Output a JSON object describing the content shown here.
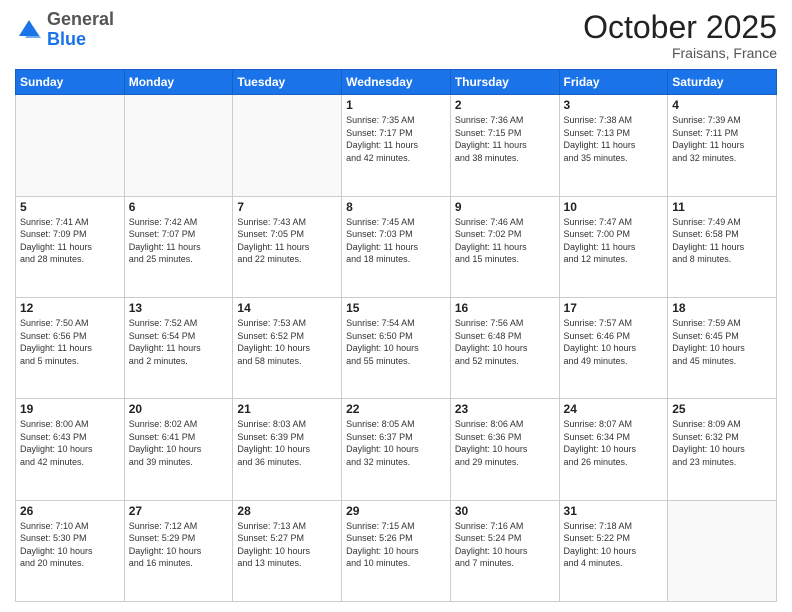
{
  "header": {
    "logo_general": "General",
    "logo_blue": "Blue",
    "month_title": "October 2025",
    "subtitle": "Fraisans, France"
  },
  "days_of_week": [
    "Sunday",
    "Monday",
    "Tuesday",
    "Wednesday",
    "Thursday",
    "Friday",
    "Saturday"
  ],
  "weeks": [
    [
      {
        "day": "",
        "info": ""
      },
      {
        "day": "",
        "info": ""
      },
      {
        "day": "",
        "info": ""
      },
      {
        "day": "1",
        "info": "Sunrise: 7:35 AM\nSunset: 7:17 PM\nDaylight: 11 hours\nand 42 minutes."
      },
      {
        "day": "2",
        "info": "Sunrise: 7:36 AM\nSunset: 7:15 PM\nDaylight: 11 hours\nand 38 minutes."
      },
      {
        "day": "3",
        "info": "Sunrise: 7:38 AM\nSunset: 7:13 PM\nDaylight: 11 hours\nand 35 minutes."
      },
      {
        "day": "4",
        "info": "Sunrise: 7:39 AM\nSunset: 7:11 PM\nDaylight: 11 hours\nand 32 minutes."
      }
    ],
    [
      {
        "day": "5",
        "info": "Sunrise: 7:41 AM\nSunset: 7:09 PM\nDaylight: 11 hours\nand 28 minutes."
      },
      {
        "day": "6",
        "info": "Sunrise: 7:42 AM\nSunset: 7:07 PM\nDaylight: 11 hours\nand 25 minutes."
      },
      {
        "day": "7",
        "info": "Sunrise: 7:43 AM\nSunset: 7:05 PM\nDaylight: 11 hours\nand 22 minutes."
      },
      {
        "day": "8",
        "info": "Sunrise: 7:45 AM\nSunset: 7:03 PM\nDaylight: 11 hours\nand 18 minutes."
      },
      {
        "day": "9",
        "info": "Sunrise: 7:46 AM\nSunset: 7:02 PM\nDaylight: 11 hours\nand 15 minutes."
      },
      {
        "day": "10",
        "info": "Sunrise: 7:47 AM\nSunset: 7:00 PM\nDaylight: 11 hours\nand 12 minutes."
      },
      {
        "day": "11",
        "info": "Sunrise: 7:49 AM\nSunset: 6:58 PM\nDaylight: 11 hours\nand 8 minutes."
      }
    ],
    [
      {
        "day": "12",
        "info": "Sunrise: 7:50 AM\nSunset: 6:56 PM\nDaylight: 11 hours\nand 5 minutes."
      },
      {
        "day": "13",
        "info": "Sunrise: 7:52 AM\nSunset: 6:54 PM\nDaylight: 11 hours\nand 2 minutes."
      },
      {
        "day": "14",
        "info": "Sunrise: 7:53 AM\nSunset: 6:52 PM\nDaylight: 10 hours\nand 58 minutes."
      },
      {
        "day": "15",
        "info": "Sunrise: 7:54 AM\nSunset: 6:50 PM\nDaylight: 10 hours\nand 55 minutes."
      },
      {
        "day": "16",
        "info": "Sunrise: 7:56 AM\nSunset: 6:48 PM\nDaylight: 10 hours\nand 52 minutes."
      },
      {
        "day": "17",
        "info": "Sunrise: 7:57 AM\nSunset: 6:46 PM\nDaylight: 10 hours\nand 49 minutes."
      },
      {
        "day": "18",
        "info": "Sunrise: 7:59 AM\nSunset: 6:45 PM\nDaylight: 10 hours\nand 45 minutes."
      }
    ],
    [
      {
        "day": "19",
        "info": "Sunrise: 8:00 AM\nSunset: 6:43 PM\nDaylight: 10 hours\nand 42 minutes."
      },
      {
        "day": "20",
        "info": "Sunrise: 8:02 AM\nSunset: 6:41 PM\nDaylight: 10 hours\nand 39 minutes."
      },
      {
        "day": "21",
        "info": "Sunrise: 8:03 AM\nSunset: 6:39 PM\nDaylight: 10 hours\nand 36 minutes."
      },
      {
        "day": "22",
        "info": "Sunrise: 8:05 AM\nSunset: 6:37 PM\nDaylight: 10 hours\nand 32 minutes."
      },
      {
        "day": "23",
        "info": "Sunrise: 8:06 AM\nSunset: 6:36 PM\nDaylight: 10 hours\nand 29 minutes."
      },
      {
        "day": "24",
        "info": "Sunrise: 8:07 AM\nSunset: 6:34 PM\nDaylight: 10 hours\nand 26 minutes."
      },
      {
        "day": "25",
        "info": "Sunrise: 8:09 AM\nSunset: 6:32 PM\nDaylight: 10 hours\nand 23 minutes."
      }
    ],
    [
      {
        "day": "26",
        "info": "Sunrise: 7:10 AM\nSunset: 5:30 PM\nDaylight: 10 hours\nand 20 minutes."
      },
      {
        "day": "27",
        "info": "Sunrise: 7:12 AM\nSunset: 5:29 PM\nDaylight: 10 hours\nand 16 minutes."
      },
      {
        "day": "28",
        "info": "Sunrise: 7:13 AM\nSunset: 5:27 PM\nDaylight: 10 hours\nand 13 minutes."
      },
      {
        "day": "29",
        "info": "Sunrise: 7:15 AM\nSunset: 5:26 PM\nDaylight: 10 hours\nand 10 minutes."
      },
      {
        "day": "30",
        "info": "Sunrise: 7:16 AM\nSunset: 5:24 PM\nDaylight: 10 hours\nand 7 minutes."
      },
      {
        "day": "31",
        "info": "Sunrise: 7:18 AM\nSunset: 5:22 PM\nDaylight: 10 hours\nand 4 minutes."
      },
      {
        "day": "",
        "info": ""
      }
    ]
  ]
}
